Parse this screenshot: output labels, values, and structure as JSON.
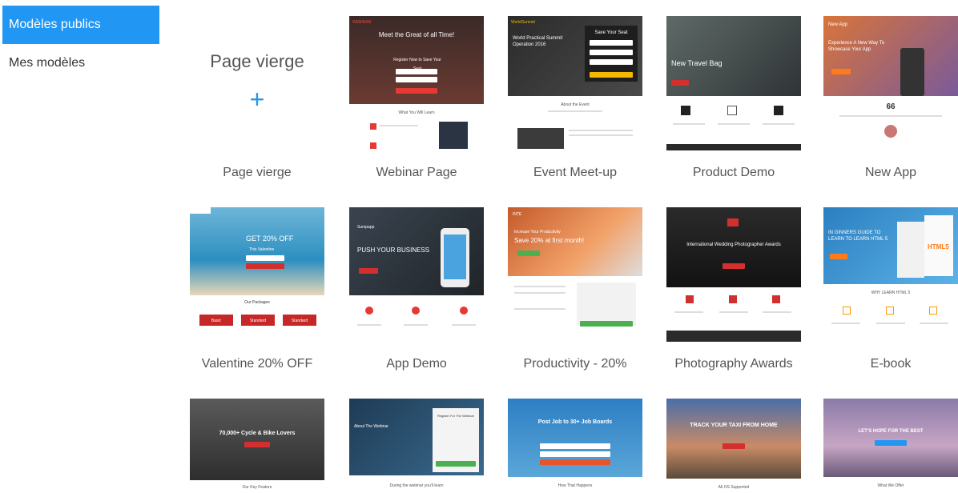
{
  "sidebar": {
    "items": [
      {
        "label": "Modèles publics"
      },
      {
        "label": "Mes modèles"
      }
    ]
  },
  "blank": {
    "title": "Page vierge",
    "icon": "plus-icon"
  },
  "templates": [
    {
      "name": "Page vierge"
    },
    {
      "name": "Webinar Page",
      "logo": "WEBINAR",
      "headline": "Meet the Great of all Time!",
      "cta": "Register Now to Save Your Seat",
      "section": "What You Will Learn"
    },
    {
      "name": "Event Meet-up",
      "logo": "WorldSummit",
      "headline": "World Practical Summit Operation 2016",
      "form_title": "Save Your Seat",
      "section": "About the Event"
    },
    {
      "name": "Product Demo",
      "headline": "New Travel Bag"
    },
    {
      "name": "New App",
      "logo": "New App",
      "headline": "Experience A New Way To Showcase Your App",
      "quote": "66"
    },
    {
      "name": "Valentine 20% OFF",
      "headline": "GET 20% OFF",
      "sub": "This Valentine",
      "section": "Our Packages",
      "tiers": [
        "Basic",
        "Standard",
        "Standard"
      ]
    },
    {
      "name": "App Demo",
      "headline": "PUSH YOUR BUSINESS",
      "brand": "Sumpapp"
    },
    {
      "name": "Productivity - 20%",
      "logo": "INTE",
      "kicker": "Increase Your Productivity",
      "headline": "Save 20% at first month!"
    },
    {
      "name": "Photography Awards",
      "headline": "International Wedding Photographer Awards"
    },
    {
      "name": "E-book",
      "headline": "IN GINNERS GUIDE TO LEARN TO LEARN HTML 5",
      "section": "WHY LEARN HTML 5",
      "book": "HTML5"
    },
    {
      "name": "",
      "headline": "70,000+ Cycle & Bike Lovers",
      "section": "Our Key Feature"
    },
    {
      "name": "",
      "headline": "About The Webinar",
      "form_title": "Register For The Webinar",
      "section": "During the webinar you'll learn"
    },
    {
      "name": "",
      "headline": "Post Job to 30+ Job Boards",
      "section": "How That Happens"
    },
    {
      "name": "",
      "headline": "TRACK YOUR TAXI FROM HOME",
      "section": "All OS Supported"
    },
    {
      "name": "",
      "headline": "LET'S HOPE FOR THE BEST",
      "section": "What We Offer"
    }
  ],
  "colors": {
    "accent": "#2196f3",
    "red": "#d32f2f",
    "orange": "#ff7a1a",
    "green": "#4caf50"
  }
}
